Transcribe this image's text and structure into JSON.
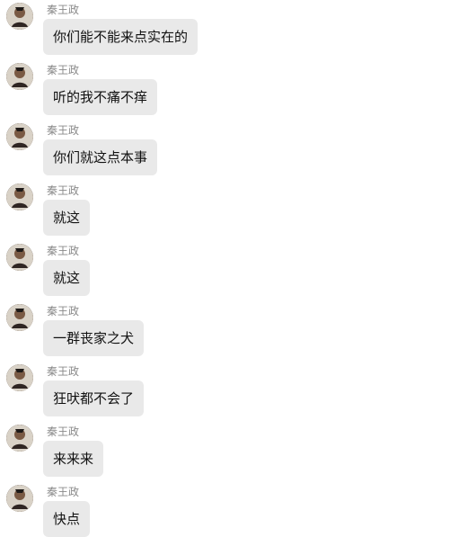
{
  "chat": {
    "messages": [
      {
        "sender": "秦王政",
        "text": "你们能不能来点实在的",
        "avatar_icon": "avatar-person-icon"
      },
      {
        "sender": "秦王政",
        "text": "听的我不痛不痒",
        "avatar_icon": "avatar-person-icon"
      },
      {
        "sender": "秦王政",
        "text": "你们就这点本事",
        "avatar_icon": "avatar-person-icon"
      },
      {
        "sender": "秦王政",
        "text": "就这",
        "avatar_icon": "avatar-person-icon"
      },
      {
        "sender": "秦王政",
        "text": "就这",
        "avatar_icon": "avatar-person-icon"
      },
      {
        "sender": "秦王政",
        "text": "一群丧家之犬",
        "avatar_icon": "avatar-person-icon"
      },
      {
        "sender": "秦王政",
        "text": "狂吠都不会了",
        "avatar_icon": "avatar-person-icon"
      },
      {
        "sender": "秦王政",
        "text": "来来来",
        "avatar_icon": "avatar-person-icon"
      },
      {
        "sender": "秦王政",
        "text": "快点",
        "avatar_icon": "avatar-person-icon"
      }
    ]
  },
  "colors": {
    "bubble_background": "#e9e9e9",
    "sender_text": "#8a8a8a",
    "message_text": "#111111"
  }
}
